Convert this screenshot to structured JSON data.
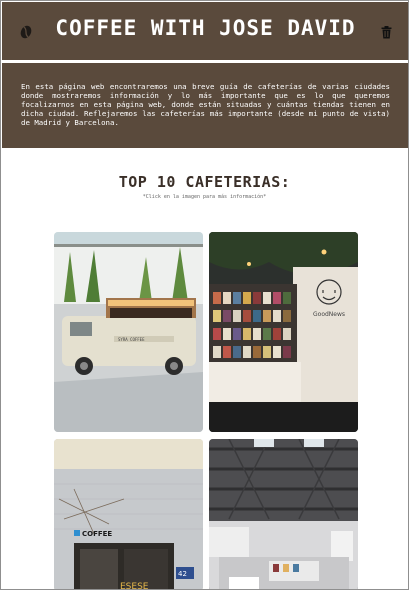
{
  "header": {
    "title": "COFFEE WITH JOSE DAVID",
    "left_icon": "coffee-bean-icon",
    "right_icon": "trash-icon"
  },
  "intro": {
    "text": "En esta página web encontraremos una breve guía de cafeterías de varias ciudades donde mostraremos información y lo más importante que es lo que queremos focalizarnos en esta página web, donde están situadas y cuántas tiendas tienen en dicha ciudad. Reflejaremos las cafeterías más importante (desde mi punto de vista) de Madrid y Barcelona."
  },
  "top": {
    "title": "TOP 10 CAFETERIAS:",
    "subtitle": "*Click en la imagen para más información*"
  },
  "gallery": [
    {
      "name": "syra-coffee",
      "sign": "SYRA COFFEE"
    },
    {
      "name": "goodnews",
      "sign": "GoodNews"
    },
    {
      "name": "coffee-shop-facade",
      "sign": "COFFEE"
    },
    {
      "name": "industrial-cafe",
      "sign": ""
    }
  ],
  "colors": {
    "header_bg": "#5a4a3c",
    "title_text": "#3a2f28"
  }
}
